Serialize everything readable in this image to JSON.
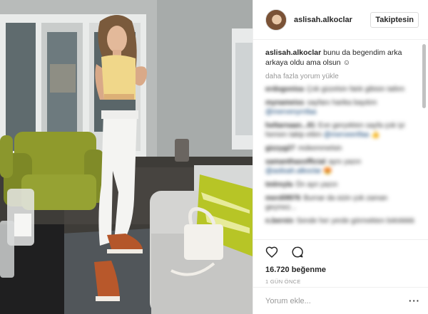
{
  "header": {
    "username": "aslisah.alkoclar",
    "follow_label": "Takiptesin"
  },
  "caption": {
    "username": "aslisah.alkoclar",
    "text": "bunu da begendim arka arkaya oldu ama olsun ☺"
  },
  "load_more_label": "daha fazla yorum yükle",
  "comments": [
    {
      "user": "erdogonisa",
      "text": "Çok güzelsin fatık gibisin tatlım"
    },
    {
      "user": "mynameiss",
      "text": "sayfanı harika baydım",
      "tag": "@mervenyrnfaa"
    },
    {
      "user": "heltarnaan...81",
      "text": "Eve gerçekten sayfa çok iyi hemen takip ettim",
      "tag": "@merveertfaa",
      "emoji": "👍"
    },
    {
      "user": "gizzyg27",
      "text": "mükemmelsin"
    },
    {
      "user": "samanthaxofficial",
      "text": "aynı yazın",
      "tag": "@aslisah.alkoclar",
      "emoji": "😍"
    },
    {
      "user": "tmlreyla",
      "text": "Ön ayn yazın"
    },
    {
      "user": "merdi9976",
      "text": "Burnar da sizin çok zaman geçmez..."
    },
    {
      "user": "n.bernin",
      "text": "Sende her yerde görmekten bıktıkkkk"
    }
  ],
  "actions": {
    "like_icon": "heart-outline-icon",
    "comment_icon": "speech-bubble-icon",
    "likes": "16.720 beğenme",
    "time": "1 GÜN ÖNCE"
  },
  "add_comment": {
    "placeholder": "Yorum ekle...",
    "more_label": "···"
  },
  "colors": {
    "border": "#efefef",
    "muted": "#999999",
    "link": "#003569",
    "text": "#262626"
  }
}
